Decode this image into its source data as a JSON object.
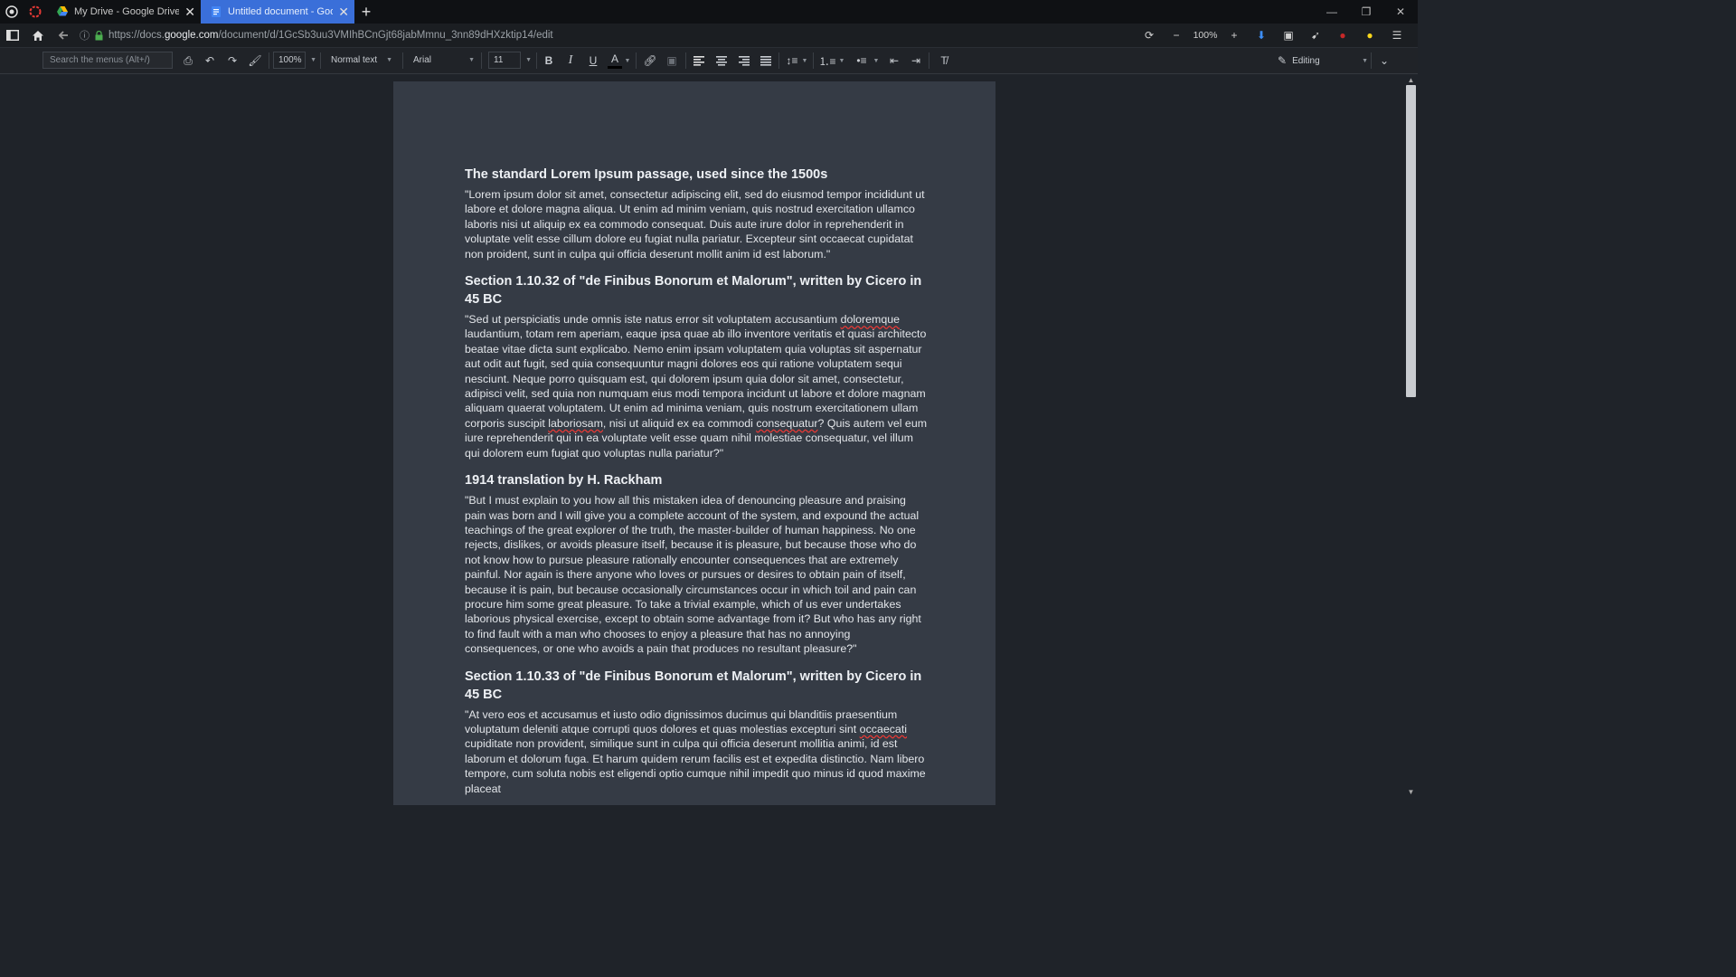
{
  "tabs": [
    {
      "title": "My Drive - Google Drive",
      "close": "✕"
    },
    {
      "title": "Untitled document - Google Docs",
      "close": "✕"
    }
  ],
  "new_tab": "+",
  "window": {
    "minimize": "—",
    "restore": "❐",
    "close": "✕"
  },
  "address": {
    "prefix": "https://docs.",
    "host": "google.com",
    "path": "/document/d/1GcSb3uu3VMIhBCnGjt68jabMmnu_3nn89dHXzktip14/edit"
  },
  "zoom": {
    "value": "100%",
    "minus": "−",
    "plus": "+"
  },
  "toolbar": {
    "search_placeholder": "Search the menus (Alt+/)",
    "zoom": "100%",
    "style": "Normal text",
    "font": "Arial",
    "size": "11",
    "bold": "B",
    "italic": "I",
    "underline": "U",
    "color": "A",
    "mode": "Editing"
  },
  "document": {
    "h1": "The standard Lorem Ipsum passage, used since the 1500s",
    "p1": "\"Lorem ipsum dolor sit amet, consectetur adipiscing elit, sed do eiusmod tempor incididunt ut labore et dolore magna aliqua. Ut enim ad minim veniam, quis nostrud exercitation ullamco laboris nisi ut aliquip ex ea commodo consequat. Duis aute irure dolor in reprehenderit in voluptate velit esse cillum dolore eu fugiat nulla pariatur. Excepteur sint occaecat cupidatat non proident, sunt in culpa qui officia deserunt mollit anim id est laborum.\"",
    "h2": "Section 1.10.32 of \"de Finibus Bonorum et Malorum\", written by Cicero in 45 BC",
    "p2a": "\"Sed ut perspiciatis unde omnis iste natus error sit voluptatem accusantium ",
    "p2_sp1": "doloremque",
    "p2b": " laudantium, totam rem aperiam, eaque ipsa quae ab illo inventore veritatis et quasi architecto beatae vitae dicta sunt explicabo. Nemo enim ipsam voluptatem quia voluptas sit aspernatur aut odit aut fugit, sed quia consequuntur magni dolores eos qui ratione voluptatem sequi nesciunt. Neque porro quisquam est, qui dolorem ipsum quia dolor sit amet, consectetur, adipisci velit, sed quia non numquam eius modi tempora incidunt ut labore et dolore magnam aliquam quaerat voluptatem. Ut enim ad minima veniam, quis nostrum exercitationem ullam corporis suscipit ",
    "p2_sp2": "laboriosam",
    "p2c": ", nisi ut aliquid ex ea commodi ",
    "p2_sp3": "consequatur",
    "p2d": "? Quis autem vel eum iure reprehenderit qui in ea voluptate velit esse quam nihil molestiae consequatur, vel illum qui dolorem eum fugiat quo voluptas nulla pariatur?\"",
    "h3": "1914 translation by H. Rackham",
    "p3": "\"But I must explain to you how all this mistaken idea of denouncing pleasure and praising pain was born and I will give you a complete account of the system, and expound the actual teachings of the great explorer of the truth, the master-builder of human happiness. No one rejects, dislikes, or avoids pleasure itself, because it is pleasure, but because those who do not know how to pursue pleasure rationally encounter consequences that are extremely painful. Nor again is there anyone who loves or pursues or desires to obtain pain of itself, because it is pain, but because occasionally circumstances occur in which toil and pain can procure him some great pleasure. To take a trivial example, which of us ever undertakes laborious physical exercise, except to obtain some advantage from it? But who has any right to find fault with a man who chooses to enjoy a pleasure that has no annoying consequences, or one who avoids a pain that produces no resultant pleasure?\"",
    "h4": "Section 1.10.33 of \"de Finibus Bonorum et Malorum\", written by Cicero in 45 BC",
    "p4a": "\"At vero eos et accusamus et iusto odio dignissimos ducimus qui blanditiis praesentium voluptatum deleniti atque corrupti quos dolores et quas molestias excepturi sint ",
    "p4_sp1": "occaecati",
    "p4b": " cupiditate non provident, similique sunt in culpa qui officia deserunt mollitia animi, id est laborum et dolorum fuga. Et harum quidem rerum facilis est et expedita distinctio. Nam libero tempore, cum soluta nobis est eligendi optio cumque nihil impedit quo minus id quod maxime placeat"
  }
}
